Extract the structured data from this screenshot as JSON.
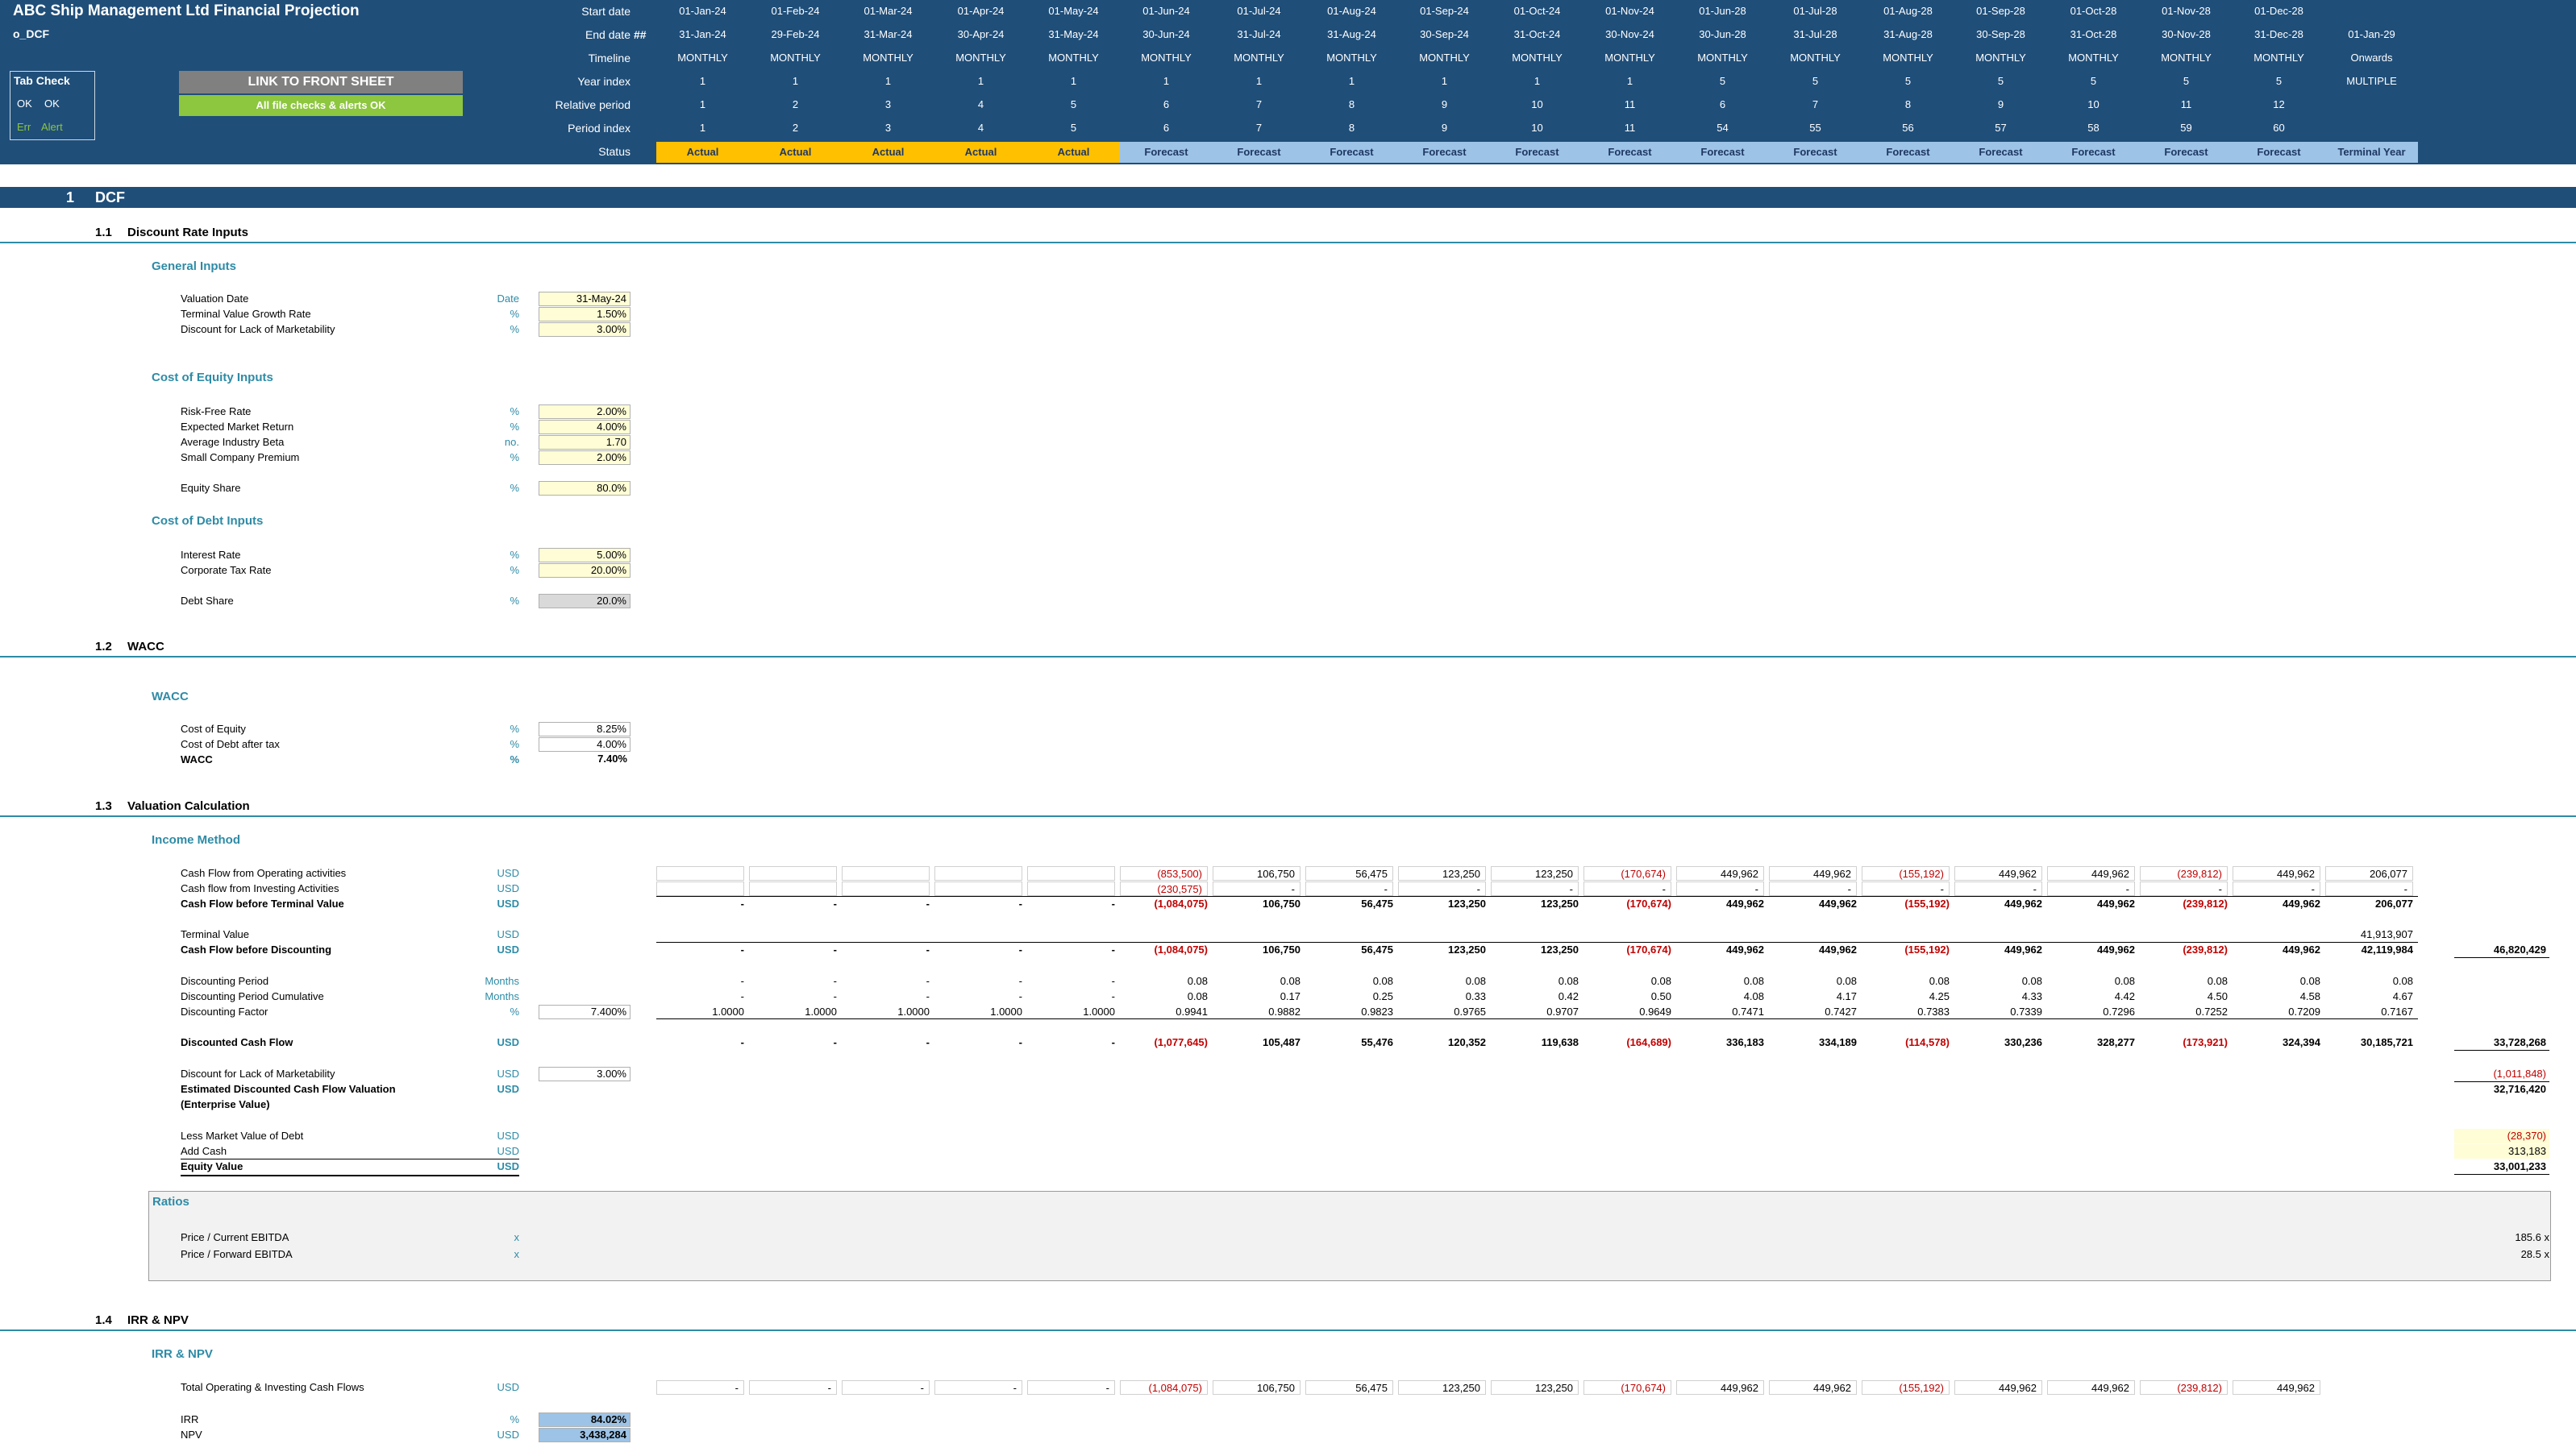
{
  "header": {
    "title": "ABC Ship Management Ltd Financial Projection",
    "sheet_name": "o_DCF",
    "labels": {
      "start_date": "Start date",
      "end_date": "End date",
      "end_date_marker": "##",
      "timeline": "Timeline",
      "year_index": "Year index",
      "relative_period": "Relative period",
      "period_index": "Period index",
      "status": "Status"
    },
    "tab_check": {
      "title": "Tab Check",
      "ok1": "OK",
      "ok2": "OK",
      "err": "Err",
      "alert": "Alert"
    },
    "link_button": "LINK TO FRONT SHEET",
    "checks_ok": "All file checks & alerts OK",
    "columns": [
      {
        "start": "01-Jan-24",
        "end": "31-Jan-24",
        "timeline": "MONTHLY",
        "year": "1",
        "rel": "1",
        "period": "1",
        "status": "Actual"
      },
      {
        "start": "01-Feb-24",
        "end": "29-Feb-24",
        "timeline": "MONTHLY",
        "year": "1",
        "rel": "2",
        "period": "2",
        "status": "Actual"
      },
      {
        "start": "01-Mar-24",
        "end": "31-Mar-24",
        "timeline": "MONTHLY",
        "year": "1",
        "rel": "3",
        "period": "3",
        "status": "Actual"
      },
      {
        "start": "01-Apr-24",
        "end": "30-Apr-24",
        "timeline": "MONTHLY",
        "year": "1",
        "rel": "4",
        "period": "4",
        "status": "Actual"
      },
      {
        "start": "01-May-24",
        "end": "31-May-24",
        "timeline": "MONTHLY",
        "year": "1",
        "rel": "5",
        "period": "5",
        "status": "Actual"
      },
      {
        "start": "01-Jun-24",
        "end": "30-Jun-24",
        "timeline": "MONTHLY",
        "year": "1",
        "rel": "6",
        "period": "6",
        "status": "Forecast"
      },
      {
        "start": "01-Jul-24",
        "end": "31-Jul-24",
        "timeline": "MONTHLY",
        "year": "1",
        "rel": "7",
        "period": "7",
        "status": "Forecast"
      },
      {
        "start": "01-Aug-24",
        "end": "31-Aug-24",
        "timeline": "MONTHLY",
        "year": "1",
        "rel": "8",
        "period": "8",
        "status": "Forecast"
      },
      {
        "start": "01-Sep-24",
        "end": "30-Sep-24",
        "timeline": "MONTHLY",
        "year": "1",
        "rel": "9",
        "period": "9",
        "status": "Forecast"
      },
      {
        "start": "01-Oct-24",
        "end": "31-Oct-24",
        "timeline": "MONTHLY",
        "year": "1",
        "rel": "10",
        "period": "10",
        "status": "Forecast"
      },
      {
        "start": "01-Nov-24",
        "end": "30-Nov-24",
        "timeline": "MONTHLY",
        "year": "1",
        "rel": "11",
        "period": "11",
        "status": "Forecast"
      },
      {
        "start": "01-Jun-28",
        "end": "30-Jun-28",
        "timeline": "MONTHLY",
        "year": "5",
        "rel": "6",
        "period": "54",
        "status": "Forecast"
      },
      {
        "start": "01-Jul-28",
        "end": "31-Jul-28",
        "timeline": "MONTHLY",
        "year": "5",
        "rel": "7",
        "period": "55",
        "status": "Forecast"
      },
      {
        "start": "01-Aug-28",
        "end": "31-Aug-28",
        "timeline": "MONTHLY",
        "year": "5",
        "rel": "8",
        "period": "56",
        "status": "Forecast"
      },
      {
        "start": "01-Sep-28",
        "end": "30-Sep-28",
        "timeline": "MONTHLY",
        "year": "5",
        "rel": "9",
        "period": "57",
        "status": "Forecast"
      },
      {
        "start": "01-Oct-28",
        "end": "31-Oct-28",
        "timeline": "MONTHLY",
        "year": "5",
        "rel": "10",
        "period": "58",
        "status": "Forecast"
      },
      {
        "start": "01-Nov-28",
        "end": "30-Nov-28",
        "timeline": "MONTHLY",
        "year": "5",
        "rel": "11",
        "period": "59",
        "status": "Forecast"
      },
      {
        "start": "01-Dec-28",
        "end": "31-Dec-28",
        "timeline": "MONTHLY",
        "year": "5",
        "rel": "12",
        "period": "60",
        "status": "Forecast"
      },
      {
        "start": "",
        "end": "01-Jan-29",
        "timeline": "Onwards",
        "year": "MULTIPLE",
        "rel": "",
        "period": "",
        "status": "Terminal Year"
      }
    ]
  },
  "colors": {
    "navy": "#1f4e79",
    "actual": "#ffc000",
    "forecast": "#9dc3e6",
    "teal": "#2e8ba6",
    "input": "#fffdd5",
    "negative": "#c00000",
    "ok_green": "#8dc63f"
  },
  "section": {
    "num": "1",
    "title": "DCF"
  },
  "s11": {
    "num": "1.1",
    "title": "Discount Rate Inputs",
    "general": {
      "heading": "General Inputs",
      "rows": [
        {
          "label": "Valuation Date",
          "unit": "Date",
          "value": "31-May-24"
        },
        {
          "label": "Terminal Value Growth Rate",
          "unit": "%",
          "value": "1.50%"
        },
        {
          "label": "Discount for Lack of Marketability",
          "unit": "%",
          "value": "3.00%"
        }
      ]
    },
    "equity": {
      "heading": "Cost of Equity Inputs",
      "rows": [
        {
          "label": "Risk-Free Rate",
          "unit": "%",
          "value": "2.00%"
        },
        {
          "label": "Expected Market Return",
          "unit": "%",
          "value": "4.00%"
        },
        {
          "label": "Average Industry Beta",
          "unit": "no.",
          "value": "1.70"
        },
        {
          "label": "Small Company Premium",
          "unit": "%",
          "value": "2.00%"
        }
      ],
      "share": {
        "label": "Equity Share",
        "unit": "%",
        "value": "80.0%"
      }
    },
    "debt": {
      "heading": "Cost of Debt Inputs",
      "rows": [
        {
          "label": "Interest Rate",
          "unit": "%",
          "value": "5.00%"
        },
        {
          "label": "Corporate Tax Rate",
          "unit": "%",
          "value": "20.00%"
        }
      ],
      "share": {
        "label": "Debt Share",
        "unit": "%",
        "value": "20.0%"
      }
    }
  },
  "s12": {
    "num": "1.2",
    "title": "WACC",
    "heading": "WACC",
    "rows": [
      {
        "label": "Cost of Equity",
        "unit": "%",
        "value": "8.25%"
      },
      {
        "label": "Cost of Debt after tax",
        "unit": "%",
        "value": "4.00%"
      },
      {
        "label": "WACC",
        "unit": "%",
        "value": "7.40%"
      }
    ]
  },
  "s13": {
    "num": "1.3",
    "title": "Valuation Calculation",
    "heading": "Income Method",
    "rows": {
      "cfo": {
        "label": "Cash Flow from Operating activities",
        "unit": "USD",
        "values": [
          "",
          "",
          "",
          "",
          "",
          "(853,500)",
          "106,750",
          "56,475",
          "123,250",
          "123,250",
          "(170,674)",
          "449,962",
          "449,962",
          "(155,192)",
          "449,962",
          "449,962",
          "(239,812)",
          "449,962",
          "206,077"
        ]
      },
      "cfi": {
        "label": "Cash flow from Investing Activities",
        "unit": "USD",
        "values": [
          "",
          "",
          "",
          "",
          "",
          "(230,575)",
          "-",
          "-",
          "-",
          "-",
          "-",
          "-",
          "-",
          "-",
          "-",
          "-",
          "-",
          "-",
          "-"
        ]
      },
      "cfbt": {
        "label": "Cash Flow before Terminal Value",
        "unit": "USD",
        "values": [
          "-",
          "-",
          "-",
          "-",
          "-",
          "(1,084,075)",
          "106,750",
          "56,475",
          "123,250",
          "123,250",
          "(170,674)",
          "449,962",
          "449,962",
          "(155,192)",
          "449,962",
          "449,962",
          "(239,812)",
          "449,962",
          "206,077"
        ]
      },
      "tv": {
        "label": "Terminal Value",
        "unit": "USD",
        "values": [
          "",
          "",
          "",
          "",
          "",
          "",
          "",
          "",
          "",
          "",
          "",
          "",
          "",
          "",
          "",
          "",
          "",
          "",
          "41,913,907"
        ]
      },
      "cfbd": {
        "label": "Cash Flow before Discounting",
        "unit": "USD",
        "values": [
          "-",
          "-",
          "-",
          "-",
          "-",
          "(1,084,075)",
          "106,750",
          "56,475",
          "123,250",
          "123,250",
          "(170,674)",
          "449,962",
          "449,962",
          "(155,192)",
          "449,962",
          "449,962",
          "(239,812)",
          "449,962",
          "42,119,984"
        ],
        "total": "46,820,429"
      },
      "dp": {
        "label": "Discounting Period",
        "unit": "Months",
        "values": [
          "-",
          "-",
          "-",
          "-",
          "-",
          "0.08",
          "0.08",
          "0.08",
          "0.08",
          "0.08",
          "0.08",
          "0.08",
          "0.08",
          "0.08",
          "0.08",
          "0.08",
          "0.08",
          "0.08",
          "0.08"
        ]
      },
      "dpc": {
        "label": "Discounting Period Cumulative",
        "unit": "Months",
        "values": [
          "-",
          "-",
          "-",
          "-",
          "-",
          "0.08",
          "0.17",
          "0.25",
          "0.33",
          "0.42",
          "0.50",
          "4.08",
          "4.17",
          "4.25",
          "4.33",
          "4.42",
          "4.50",
          "4.58",
          "4.67"
        ]
      },
      "df": {
        "label": "Discounting Factor",
        "unit": "%",
        "input": "7.400%",
        "values": [
          "1.0000",
          "1.0000",
          "1.0000",
          "1.0000",
          "1.0000",
          "0.9941",
          "0.9882",
          "0.9823",
          "0.9765",
          "0.9707",
          "0.9649",
          "0.7471",
          "0.7427",
          "0.7383",
          "0.7339",
          "0.7296",
          "0.7252",
          "0.7209",
          "0.7167"
        ]
      },
      "dcf": {
        "label": "Discounted Cash Flow",
        "unit": "USD",
        "values": [
          "-",
          "-",
          "-",
          "-",
          "-",
          "(1,077,645)",
          "105,487",
          "55,476",
          "120,352",
          "119,638",
          "(164,689)",
          "336,183",
          "334,189",
          "(114,578)",
          "330,236",
          "328,277",
          "(173,921)",
          "324,394",
          "30,185,721"
        ],
        "total": "33,728,268"
      },
      "dlom": {
        "label": "Discount for Lack of Marketability",
        "unit": "USD",
        "input": "3.00%",
        "total": "(1,011,848)"
      },
      "edcf": {
        "label": "Estimated Discounted Cash Flow Valuation",
        "label2": "(Enterprise Value)",
        "unit": "USD",
        "total": "32,716,420"
      },
      "debt": {
        "label": "Less Market Value of Debt",
        "unit": "USD",
        "total": "(28,370)"
      },
      "cash": {
        "label": "Add Cash",
        "unit": "USD",
        "total": "313,183"
      },
      "eq": {
        "label": "Equity Value",
        "unit": "USD",
        "total": "33,001,233"
      }
    },
    "ratios": {
      "heading": "Ratios",
      "rows": [
        {
          "label": "Price / Current EBITDA",
          "unit": "x",
          "value": "185.6 x"
        },
        {
          "label": "Price / Forward EBITDA",
          "unit": "x",
          "value": "28.5 x"
        }
      ]
    }
  },
  "s14": {
    "num": "1.4",
    "title": "IRR & NPV",
    "heading": "IRR & NPV",
    "toicf": {
      "label": "Total Operating & Investing Cash Flows",
      "unit": "USD",
      "values": [
        "-",
        "-",
        "-",
        "-",
        "-",
        "(1,084,075)",
        "106,750",
        "56,475",
        "123,250",
        "123,250",
        "(170,674)",
        "449,962",
        "449,962",
        "(155,192)",
        "449,962",
        "449,962",
        "(239,812)",
        "449,962"
      ]
    },
    "irr": {
      "label": "IRR",
      "unit": "%",
      "value": "84.02%"
    },
    "npv": {
      "label": "NPV",
      "unit": "USD",
      "value": "3,438,284"
    }
  }
}
